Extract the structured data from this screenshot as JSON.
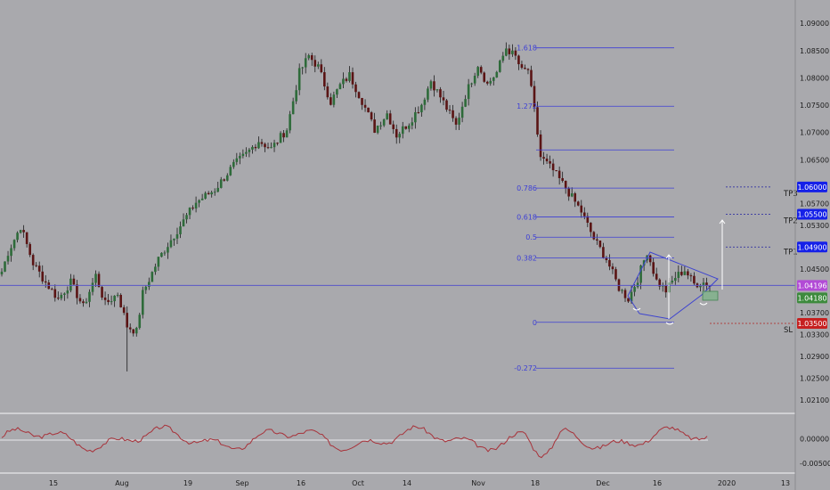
{
  "colors": {
    "background": "#a9a9ad",
    "candle_up": "#2e6b3a",
    "candle_down": "#5a1414",
    "wick": "#1b1b1b",
    "fib_line": "#3d3fd6",
    "fib_label": "#3d3fd6",
    "current_price_line": "#5a57c8",
    "pattern_line": "#3e44cf",
    "target_line": "#2020a0",
    "sl_line": "#b02020",
    "tp_badge": "#1520e8",
    "current_badge": "#b24bd6",
    "bid_badge": "#3d8a3d",
    "sl_badge": "#c62020",
    "oscillator": "#a8323a",
    "axis_text": "#1c1c1c"
  },
  "price_axis": {
    "min": 1.019,
    "max": 1.091,
    "labels": [
      "1.09000",
      "1.08500",
      "1.08000",
      "1.07500",
      "1.07000",
      "1.06500",
      "1.05700",
      "1.05300",
      "1.04500",
      "1.03700",
      "1.03300",
      "1.02900",
      "1.02500",
      "1.02100"
    ]
  },
  "time_axis": {
    "labels": [
      "15",
      "Aug",
      "19",
      "Sep",
      "16",
      "Oct",
      "14",
      "Nov",
      "18",
      "Dec",
      "16",
      "2020",
      "13"
    ]
  },
  "oscillator_axis": {
    "labels": [
      "0.00000",
      "-0.00500"
    ],
    "min": -0.0065,
    "max": 0.0045
  },
  "fib_levels": [
    {
      "label": "1.618",
      "price": 1.0855
    },
    {
      "label": "1.272",
      "price": 1.0748
    },
    {
      "label": "",
      "price": 1.0668
    },
    {
      "label": "0.786",
      "price": 1.0598
    },
    {
      "label": "0.618",
      "price": 1.0545
    },
    {
      "label": "0.5",
      "price": 1.0508
    },
    {
      "label": "0.382",
      "price": 1.047
    },
    {
      "label": "0",
      "price": 1.0352
    },
    {
      "label": "-0.272",
      "price": 1.0268
    }
  ],
  "price_badges": [
    {
      "text": "1.06000",
      "price": 1.06,
      "kind": "tp"
    },
    {
      "text": "1.05500",
      "price": 1.055,
      "kind": "tp"
    },
    {
      "text": "1.04900",
      "price": 1.049,
      "kind": "tp"
    },
    {
      "text": "1.04196",
      "price": 1.04196,
      "kind": "current"
    },
    {
      "text": "1.04180",
      "price": 1.0418,
      "kind": "bid"
    },
    {
      "text": "1.03500",
      "price": 1.035,
      "kind": "sl"
    }
  ],
  "targets": [
    {
      "label": "TP3",
      "price": 1.06
    },
    {
      "label": "TP2",
      "price": 1.055
    },
    {
      "label": "TP1",
      "price": 1.049
    },
    {
      "label": "SL",
      "price": 1.035
    }
  ],
  "chart_data": {
    "type": "candlestick",
    "anchors": [
      [
        0,
        1.0445
      ],
      [
        2,
        1.048
      ],
      [
        6,
        1.0528
      ],
      [
        10,
        1.046
      ],
      [
        14,
        1.0425
      ],
      [
        18,
        1.0395
      ],
      [
        22,
        1.0425
      ],
      [
        26,
        1.038
      ],
      [
        30,
        1.0438
      ],
      [
        33,
        1.0385
      ],
      [
        37,
        1.0405
      ],
      [
        40,
        1.0345
      ],
      [
        43,
        1.0335
      ],
      [
        45,
        1.0405
      ],
      [
        50,
        1.0468
      ],
      [
        55,
        1.0512
      ],
      [
        62,
        1.0572
      ],
      [
        68,
        1.0595
      ],
      [
        74,
        1.064
      ],
      [
        78,
        1.066
      ],
      [
        82,
        1.0685
      ],
      [
        86,
        1.067
      ],
      [
        91,
        1.0706
      ],
      [
        95,
        1.081
      ],
      [
        98,
        1.084
      ],
      [
        101,
        1.082
      ],
      [
        105,
        1.0756
      ],
      [
        108,
        1.0786
      ],
      [
        111,
        1.0805
      ],
      [
        115,
        1.0758
      ],
      [
        119,
        1.0705
      ],
      [
        123,
        1.0735
      ],
      [
        126,
        1.0695
      ],
      [
        130,
        1.0718
      ],
      [
        134,
        1.0752
      ],
      [
        137,
        1.0795
      ],
      [
        141,
        1.0755
      ],
      [
        145,
        1.0712
      ],
      [
        148,
        1.0768
      ],
      [
        152,
        1.0825
      ],
      [
        155,
        1.0788
      ],
      [
        158,
        1.081
      ],
      [
        161,
        1.0855
      ],
      [
        164,
        1.0838
      ],
      [
        166,
        1.0812
      ],
      [
        168,
        1.0815
      ],
      [
        170,
        1.074
      ],
      [
        172,
        1.0655
      ],
      [
        176,
        1.063
      ],
      [
        180,
        1.0598
      ],
      [
        185,
        1.0555
      ],
      [
        189,
        1.0505
      ],
      [
        193,
        1.0468
      ],
      [
        197,
        1.0415
      ],
      [
        200,
        1.0395
      ],
      [
        203,
        1.0432
      ],
      [
        206,
        1.0482
      ],
      [
        209,
        1.0428
      ],
      [
        212,
        1.041
      ],
      [
        215,
        1.0435
      ],
      [
        218,
        1.0448
      ],
      [
        221,
        1.0422
      ],
      [
        224,
        1.0425
      ],
      [
        226,
        1.042
      ]
    ]
  }
}
